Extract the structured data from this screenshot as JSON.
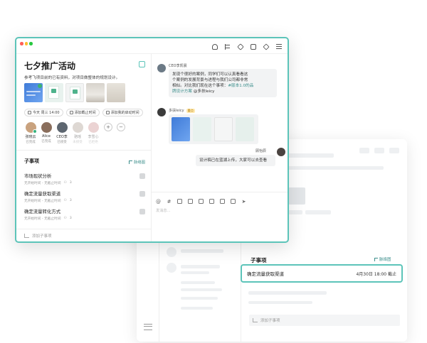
{
  "front": {
    "project_title": "七夕推广活动",
    "project_desc": "参考飞项目前的已有资料，对项目做整体的规划设计。",
    "chips": [
      "今天 周三 14:00",
      "添加截止时间",
      "添加我的启动时间"
    ],
    "members": [
      {
        "name": "张晓云",
        "status": "已完成",
        "color": "#c9a27e",
        "done": true
      },
      {
        "name": "Alice",
        "status": "已完成",
        "color": "#8a6e5c",
        "done": false
      },
      {
        "name": "CEO李",
        "status": "已接受",
        "color": "#5d6670",
        "done": false
      },
      {
        "name": "骆瑶",
        "status": "未接受",
        "color": "#b7aaa0",
        "done": false
      },
      {
        "name": "李雪心",
        "status": "已拒绝",
        "color": "#d4a0a0",
        "done": false
      }
    ],
    "add_button": "+",
    "remove_button": "−",
    "subtasks_heading": "子事项",
    "tree_link": "脉络图",
    "tasks": [
      {
        "name": "市场现状分析",
        "meta1": "无开始时间 - 无截止时间",
        "count": "3"
      },
      {
        "name": "确定流量获取渠道",
        "meta1": "无开始时间 - 无截止时间",
        "count": "3"
      },
      {
        "name": "确定流量转化方式",
        "meta1": "无开始时间 - 无截止时间",
        "count": "3"
      }
    ],
    "add_subtask": "添加子事项"
  },
  "chat": {
    "msg1_name": "CEO李凯晨",
    "msg1_text_a": "发现个很好的案例，同学们可以认真看看这",
    "msg1_text_b": "个案例的发展背景与进程与我们公司都非常",
    "msg1_text_c": "相似。对比我们现在这个事项：",
    "msg1_link": "#版本1.0的品",
    "msg1_link_b": "牌设计方案",
    "msg1_mention": "@多扶leicy",
    "msg2_name": "多扶leicy",
    "msg2_tag": "重点",
    "msg3_name": "顾怡辰",
    "msg3_text": "设计稿已在蓝湖上传，大家可以去查看",
    "input_placeholder": "发消息..."
  },
  "back": {
    "subtasks_heading": "子事项",
    "tree_link": "脉络图",
    "task_name": "确定流量获取渠道",
    "task_due": "4月30日 18:00 截止",
    "add_subtask": "添加子事项"
  },
  "colors": {
    "accent": "#5cc4b9",
    "link": "#3a8d8a",
    "window_close": "#ff5f57",
    "window_min": "#ffbd2e",
    "window_max": "#28c840"
  }
}
